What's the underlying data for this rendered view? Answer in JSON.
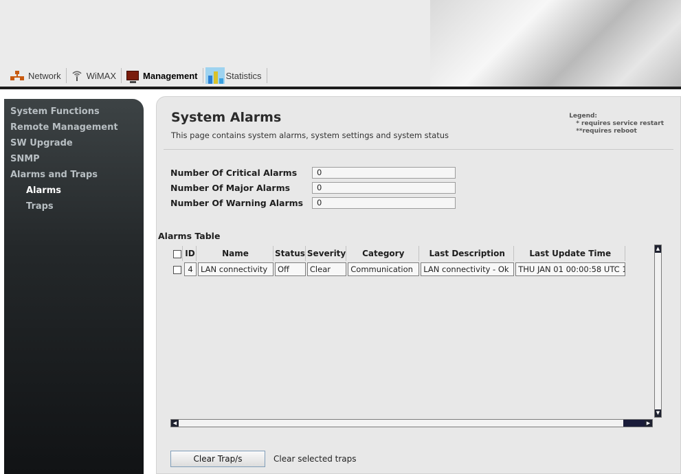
{
  "topnav": {
    "items": [
      {
        "label": "Network",
        "icon": "network-icon"
      },
      {
        "label": "WiMAX",
        "icon": "wimax-icon"
      },
      {
        "label": "Management",
        "icon": "management-icon",
        "active": true
      },
      {
        "label": "Statistics",
        "icon": "statistics-icon"
      }
    ]
  },
  "sidebar": {
    "items": [
      {
        "label": "System Functions"
      },
      {
        "label": "Remote Management"
      },
      {
        "label": "SW Upgrade"
      },
      {
        "label": "SNMP"
      },
      {
        "label": "Alarms and Traps"
      },
      {
        "label": "Alarms",
        "active": true
      },
      {
        "label": "Traps"
      }
    ]
  },
  "page": {
    "title": "System Alarms",
    "description": "This page contains system alarms, system settings and system status"
  },
  "legend": {
    "title": "Legend:",
    "marker1": "*",
    "line1": "requires service restart",
    "marker2": "**",
    "line2": "requires reboot"
  },
  "stats": {
    "critical": {
      "label": "Number Of Critical Alarms",
      "value": "0"
    },
    "major": {
      "label": "Number Of Major Alarms",
      "value": "0"
    },
    "warning": {
      "label": "Number Of Warning Alarms",
      "value": "0"
    }
  },
  "alarms_table": {
    "title": "Alarms Table",
    "columns": [
      "ID",
      "Name",
      "Status",
      "Severity",
      "Category",
      "Last Description",
      "Last Update Time"
    ],
    "rows": [
      {
        "id": "4",
        "name": "LAN connectivity",
        "status": "Off",
        "severity": "Clear",
        "category": "Communication",
        "last_description": "LAN connectivity - Ok",
        "last_update_time": "THU JAN 01 00:00:58 UTC 1"
      }
    ]
  },
  "actions": {
    "clear_button": "Clear Trap/s",
    "clear_description": "Clear selected traps"
  },
  "colors": {
    "sidebar_bg": "#24282a",
    "sidebar_text": "#b8bfc3",
    "panel_bg": "#e8e8e8",
    "scroll_button": "#1f2230"
  }
}
